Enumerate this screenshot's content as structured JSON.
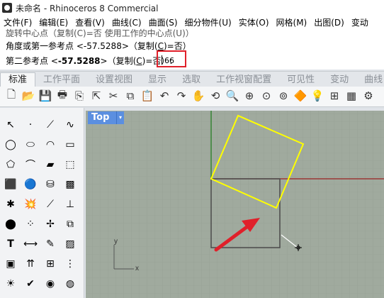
{
  "window": {
    "title": "未命名 - Rhinoceros 8 Commercial"
  },
  "menu": [
    "文件(F)",
    "编辑(E)",
    "查看(V)",
    "曲线(C)",
    "曲面(S)",
    "细分物件(U)",
    "实体(O)",
    "网格(M)",
    "出图(D)",
    "变动"
  ],
  "command_history": {
    "line1": "旋转中心点（复制(C)=否   使用工作的中心点(U)）",
    "line2_prefix": "角度或第一参考点 <-57.5288>（复制(",
    "line2_key": "C",
    "line2_suffix": ")=否）"
  },
  "command_prompt": {
    "prefix": "第二参考点 <",
    "value": "-57.5288",
    "middle": ">（复制(",
    "key": "C",
    "suffix": ")=否）:",
    "input_value": "66"
  },
  "tabs": [
    "标准",
    "工作平面",
    "设置视图",
    "显示",
    "选取",
    "工作视窗配置",
    "可见性",
    "变动",
    "曲线"
  ],
  "active_tab": "标准",
  "toolbar_icons": [
    "new-document-icon",
    "open-folder-icon",
    "save-icon",
    "print-icon",
    "import-icon",
    "cut-icon",
    "copy-icon",
    "paste-icon",
    "undo-icon",
    "pan-hand-icon",
    "rotate-view-icon",
    "zoom-icon",
    "zoom-window-icon",
    "zoom-extents-icon",
    "zoom-selected-icon",
    "properties-icon",
    "layer-icon",
    "four-viewports-icon",
    "settings-icon"
  ],
  "viewport": {
    "name": "Top",
    "dropdown_glyph": "▾",
    "axis_y_label": "y",
    "axis_x_label": "x",
    "background_color": "#a0aa9e",
    "grid_color": "#8f998d",
    "axis_x_color": "#9a2020",
    "axis_y_color": "#1a7a1a",
    "square_color": "#ffff00",
    "rect_color": "#444444",
    "arrow_color": "#e0202a"
  },
  "accent": {
    "highlight_box": "#e0202a",
    "viewport_tab": "#5b8fe0"
  }
}
